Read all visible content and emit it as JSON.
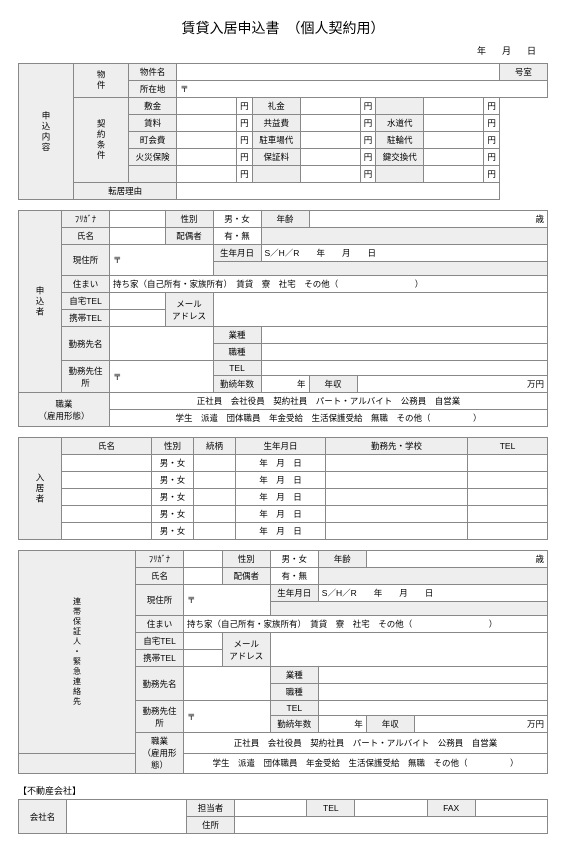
{
  "title": "賃貸入居申込書　（個人契約用）",
  "date": {
    "y": "年",
    "m": "月",
    "d": "日"
  },
  "s1": {
    "side": "申込内容",
    "side2": "物件",
    "side3": "契約条件",
    "prop_name": "物件名",
    "room": "号室",
    "addr": "所在地",
    "post": "〒",
    "deposit": "敷金",
    "key": "礼金",
    "yen": "円",
    "rent": "賃料",
    "common": "共益費",
    "water": "水道代",
    "town": "町会費",
    "parking": "駐車場代",
    "bike": "駐輪代",
    "fire": "火災保険",
    "guarantee": "保証料",
    "keyex": "鍵交換代",
    "reason": "転居理由"
  },
  "s2": {
    "side": "申込者",
    "kana": "ﾌﾘｶﾞﾅ",
    "name": "氏名",
    "gender": "性別",
    "mw": "男・女",
    "age": "年齢",
    "sai": "歳",
    "spouse": "配偶者",
    "yn": "有・無",
    "addr": "現住所",
    "post": "〒",
    "dob": "生年月日",
    "era": "S／H／R",
    "y": "年",
    "m": "月",
    "d": "日",
    "housing": "住まい",
    "housing_opts": "持ち家（自己所有・家族所有）　賃貸　寮　社宅　その他（　　　　　　　　　）",
    "htel": "自宅TEL",
    "mtel": "携帯TEL",
    "mail": "メール",
    "mailaddr": "アドレス",
    "work": "勤務先名",
    "workaddr": "勤務先住所",
    "industry": "業種",
    "position": "職種",
    "tel": "TEL",
    "tenure": "勤続年数",
    "income": "年収",
    "man": "万円",
    "job": "職業",
    "jobform": "（雇用形態）",
    "job_opts1": "正社員　会社役員　契約社員　パート・アルバイト　公務員　自営業",
    "job_opts2": "学生　派遣　団体職員　年金受給　生活保護受給　無職　その他（　　　　　）"
  },
  "s3": {
    "side": "入居者",
    "name": "氏名",
    "gender": "性別",
    "rel": "続柄",
    "dob": "生年月日",
    "school": "勤務先・学校",
    "tel": "TEL",
    "mw": "男・女",
    "y": "年",
    "m": "月",
    "d": "日"
  },
  "s4": {
    "side": "連帯保証人・緊急連絡先"
  },
  "s5": {
    "title": "【不動産会社】",
    "company": "会社名",
    "staff": "担当者",
    "tel": "TEL",
    "fax": "FAX",
    "addr": "住所"
  }
}
